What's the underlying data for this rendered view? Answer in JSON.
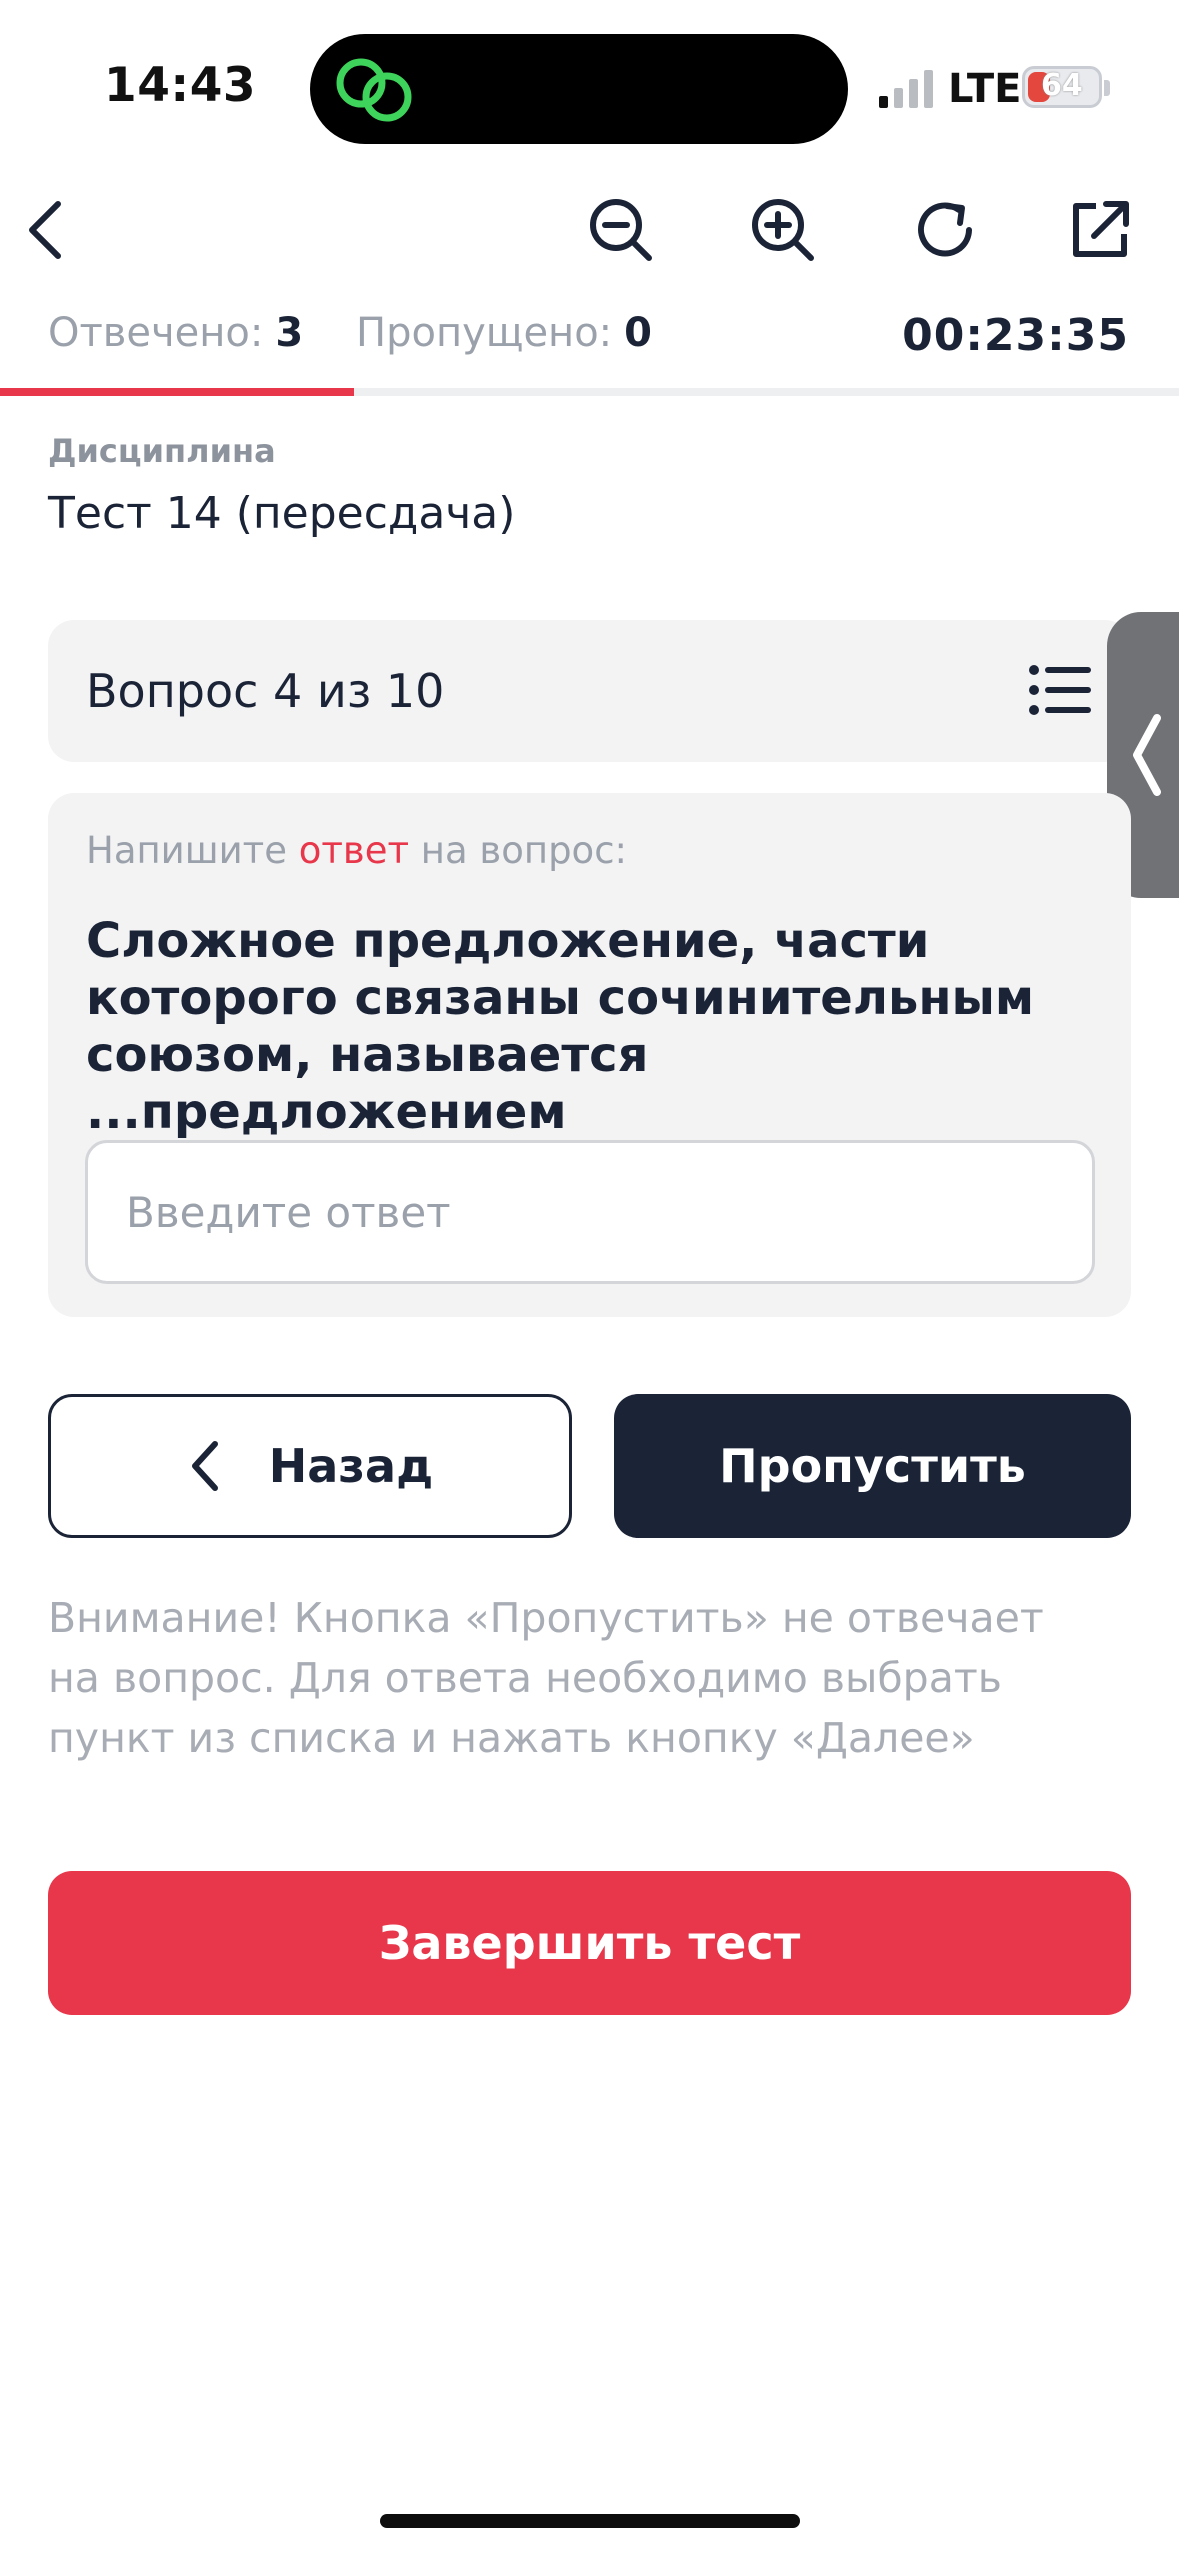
{
  "status_bar": {
    "time": "14:43",
    "network": "LTE",
    "battery": "64",
    "island_icon": "link-rings-icon"
  },
  "toolbar": {
    "icons": [
      "back-arrow-icon",
      "zoom-out-icon",
      "zoom-in-icon",
      "refresh-icon",
      "external-link-icon"
    ]
  },
  "stats": {
    "answered_label": "Отвечено:",
    "answered_value": "3",
    "skipped_label": "Пропущено:",
    "skipped_value": "0",
    "timer": "00:23:35",
    "progress_fraction": 0.3
  },
  "discipline": {
    "label": "Дисциплина",
    "value": "Тест 14 (пересдача)"
  },
  "question_header": {
    "title": "Вопрос 4 из 10",
    "list_icon": "list-icon"
  },
  "question": {
    "hint_before": "Напишите ",
    "hint_accent": "ответ",
    "hint_after": " на вопрос:",
    "text": "Сложное предложение, части которого связаны сочинительным союзом, называется ...предложением",
    "input_placeholder": "Введите ответ",
    "input_value": ""
  },
  "buttons": {
    "back": "Назад",
    "skip": "Пропустить",
    "finish": "Завершить тест"
  },
  "notice": "Внимание! Кнопка «Пропустить» не отвечает на вопрос. Для ответа необходимо выбрать пункт из списка и нажать кнопку «Далее»",
  "colors": {
    "accent": "#e8364a",
    "dark": "#1b2437",
    "muted": "#9aa1ab",
    "card_bg": "#f3f3f4"
  }
}
